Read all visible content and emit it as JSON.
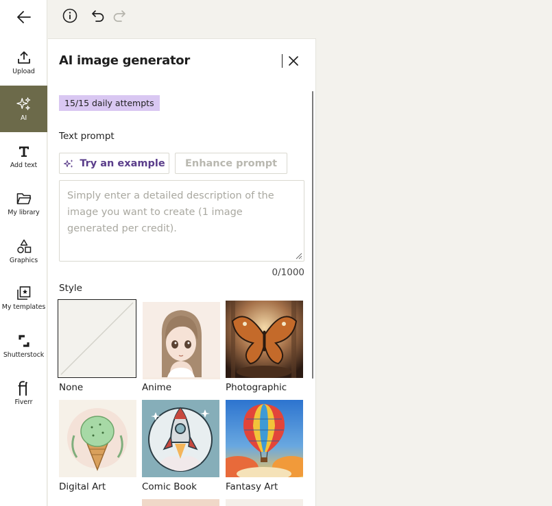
{
  "rail": {
    "items": [
      {
        "label": "Upload",
        "icon": "upload-icon"
      },
      {
        "label": "AI",
        "icon": "sparkle-icon"
      },
      {
        "label": "Add text",
        "icon": "text-icon"
      },
      {
        "label": "My library",
        "icon": "folder-icon"
      },
      {
        "label": "Graphics",
        "icon": "shapes-icon"
      },
      {
        "label": "My templates",
        "icon": "templates-icon"
      },
      {
        "label": "Shutterstock",
        "icon": "shutterstock-icon"
      },
      {
        "label": "Fiverr",
        "icon": "fiverr-icon"
      }
    ],
    "active_index": 1
  },
  "panel": {
    "title": "AI image generator",
    "attempts": "15/15 daily attempts",
    "text_prompt_label": "Text prompt",
    "try_example_label": "Try an example",
    "enhance_label": "Enhance prompt",
    "prompt_placeholder": "Simply enter a detailed description of the image you want to create (1 image generated per credit).",
    "char_count": "0/1000",
    "style_label": "Style",
    "styles": [
      {
        "label": "None",
        "selected": true
      },
      {
        "label": "Anime"
      },
      {
        "label": "Photographic"
      },
      {
        "label": "Digital Art"
      },
      {
        "label": "Comic Book"
      },
      {
        "label": "Fantasy Art"
      }
    ]
  },
  "colors": {
    "accent_active": "#6c6a4a",
    "badge_bg": "#d9c7f2",
    "try_text": "#5a3d8a"
  }
}
